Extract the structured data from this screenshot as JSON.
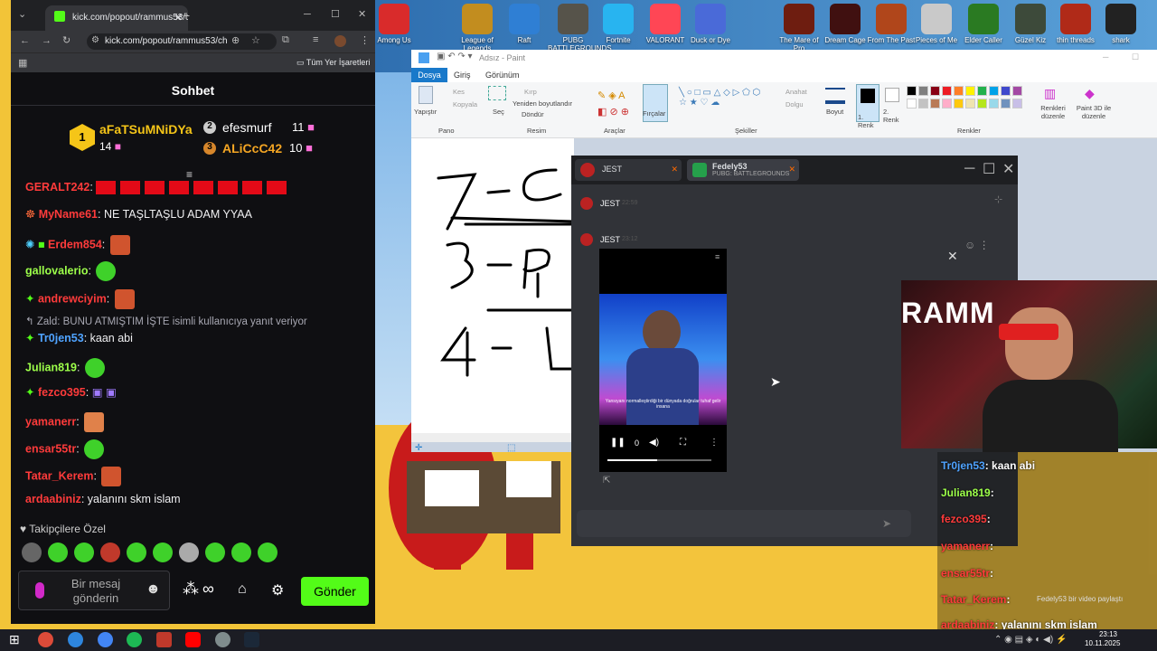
{
  "desktop": {
    "icons": [
      {
        "label": "Among Us",
        "color": "#d92b2b"
      },
      {
        "label": "League of Legends",
        "color": "#c28d1f"
      },
      {
        "label": "Raft",
        "color": "#2f7fd4"
      },
      {
        "label": "PUBG BATTLEGROUNDS",
        "color": "#56534a"
      },
      {
        "label": "Fortnite",
        "color": "#28b4f0"
      },
      {
        "label": "VALORANT",
        "color": "#ff4655"
      },
      {
        "label": "Duck or Dye",
        "color": "#4a6ad8"
      },
      {
        "label": "The Mare of Pro",
        "color": "#6e1d10"
      },
      {
        "label": "Dream Cage",
        "color": "#401010"
      },
      {
        "label": "From The Past",
        "color": "#b0461b"
      },
      {
        "label": "Pieces of Me",
        "color": "#c9c9c9"
      },
      {
        "label": "Elder Caller",
        "color": "#2a7a22"
      },
      {
        "label": "Güzel Kiz",
        "color": "#3d4a3a"
      },
      {
        "label": "thin threads",
        "color": "#b02a18"
      },
      {
        "label": "shark",
        "color": "#222"
      }
    ]
  },
  "browser": {
    "tab_title": "kick.com/popout/rammus53/ch",
    "url": "kick.com/popout/rammus53/ch",
    "bookmarks_label": "Tüm Yer İşaretleri"
  },
  "chat": {
    "title": "Sohbet",
    "leaders": [
      {
        "rank": "1",
        "name": "aFaTSuMNiDYa",
        "count": "14"
      },
      {
        "rank": "2",
        "name": "efesmurf",
        "count": "11"
      },
      {
        "rank": "3",
        "name": "ALiCcC42",
        "count": "10"
      }
    ],
    "messages": [
      {
        "user": "GERALT242",
        "text": "",
        "color": "#ff3b3b",
        "flags": 8
      },
      {
        "user": "MyName61",
        "text": ": NE TAŞLTAŞLU ADAM YYAA",
        "color": "#ff3b3b"
      },
      {
        "user": "Erdem854",
        "text": "",
        "color": "#ff3b3b"
      },
      {
        "user": "gallovalerio",
        "text": "",
        "color": "#9dff4a"
      },
      {
        "user": "andrewciyim",
        "text": "",
        "color": "#ff3b3b"
      },
      {
        "user": "Tr0jen53",
        "text": ": kaan abi",
        "color": "#4fa3ff",
        "reply": "Zald: BUNU ATMIŞTIM İŞTE isimli kullanıcıya yanıt veriyor"
      },
      {
        "user": "Julian819",
        "text": "",
        "color": "#9dff4a"
      },
      {
        "user": "fezco395",
        "text": "",
        "color": "#ff3b3b"
      },
      {
        "user": "yamanerr",
        "text": "",
        "color": "#ff3b3b"
      },
      {
        "user": "ensar55tr",
        "text": "",
        "color": "#ff3b3b"
      },
      {
        "user": "Tatar_Kerem",
        "text": "",
        "color": "#ff3b3b"
      },
      {
        "user": "ardaabiniz",
        "text": ": yalanını skm islam",
        "color": "#ff3b3b"
      }
    ],
    "followers_label": "Takipçilere Özel",
    "input_placeholder": "Bir mesaj gönderin",
    "send_label": "Gönder"
  },
  "paint": {
    "title": "Adsız - Paint",
    "tabs": [
      "Dosya",
      "Giriş",
      "Görünüm"
    ],
    "groups": {
      "pano": "Pano",
      "resim": "Resim",
      "araclar": "Araçlar",
      "sekiller": "Şekiller",
      "renkler": "Renkler"
    },
    "labels": {
      "yapistir": "Yapıştır",
      "kes": "Kes",
      "kopyala": "Kopyala",
      "sec": "Seç",
      "kirp": "Kırp",
      "yeniden": "Yeniden boyutlandır",
      "dondur": "Döndür",
      "fircalar": "Fırçalar",
      "anahat": "Anahat",
      "dolgu": "Dolgu",
      "boyut": "Boyut",
      "renk1": "1. Renk",
      "renk2": "2. Renk",
      "renkleri": "Renkleri düzenle",
      "paint3d": "Paint 3D ile düzenle"
    },
    "palette": [
      "#000000",
      "#7f7f7f",
      "#880015",
      "#ed1c24",
      "#ff7f27",
      "#fff200",
      "#22b14c",
      "#00a2e8",
      "#3f48cc",
      "#a349a4",
      "#ffffff",
      "#c3c3c3",
      "#b97a57",
      "#ffaec9",
      "#ffc90e",
      "#efe4b0",
      "#b5e61d",
      "#99d9ea",
      "#7092be",
      "#c8bfe7"
    ],
    "canvas_lines": [
      "7-C",
      "3-Pu",
      "4-L"
    ]
  },
  "discord": {
    "tabs": [
      {
        "label": "JEST"
      },
      {
        "label": "Fedely53",
        "sub": "PUBG: BATTLEGROUNDS"
      }
    ],
    "messages": [
      {
        "user": "JEST",
        "time": "22:59"
      },
      {
        "user": "JEST",
        "time": "23:12"
      }
    ],
    "video": {
      "caption": "Yansıyanı normalleştirdiği bir dünyada doğrular tuhaf gelir insana",
      "time": "0"
    }
  },
  "overlay": {
    "messages": [
      {
        "user": "Tr0jen53",
        "text": "kaan abi",
        "color": "#4fa3ff"
      },
      {
        "user": "Julian819",
        "text": "",
        "color": "#9dff4a"
      },
      {
        "user": "fezco395",
        "text": "",
        "color": "#ff3b3b"
      },
      {
        "user": "yamanerr",
        "text": "",
        "color": "#ff3b3b"
      },
      {
        "user": "ensar55tr",
        "text": "",
        "color": "#ff3b3b"
      },
      {
        "user": "Tatar_Kerem",
        "text": "",
        "color": "#ff3b3b"
      },
      {
        "user": "ardaabiniz",
        "text": "yalanını skm islam",
        "color": "#ff3b3b"
      }
    ],
    "notification": "Fedely53 bir video paylaştı"
  },
  "taskbar": {
    "time": "23:13",
    "date": "10.11.2025"
  }
}
